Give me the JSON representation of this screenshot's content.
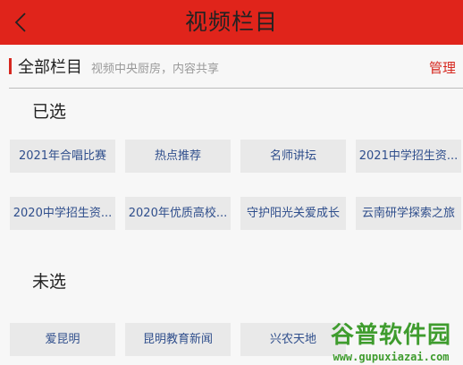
{
  "header": {
    "title": "视频栏目"
  },
  "subbar": {
    "label": "全部栏目",
    "hint": "视频中央厨房，内容共享",
    "manage": "管理"
  },
  "selected": {
    "label": "已选",
    "tags": [
      "2021年合唱比赛",
      "热点推荐",
      "名师讲坛",
      "2021中学招生资...",
      "2020中学招生资...",
      "2020年优质高校...",
      "守护阳光关爱成长",
      "云南研学探索之旅"
    ]
  },
  "unselected": {
    "label": "未选",
    "tags": [
      "爱昆明",
      "昆明教育新闻",
      "兴农天地"
    ]
  },
  "watermark": {
    "name": "谷普软件园",
    "url": "www.gupuxiazai.com"
  },
  "colors": {
    "header_bg": "#e0241b",
    "accent": "#d6281f",
    "tag_text": "#2f4e8c",
    "tag_bg": "#e9e9e9"
  }
}
